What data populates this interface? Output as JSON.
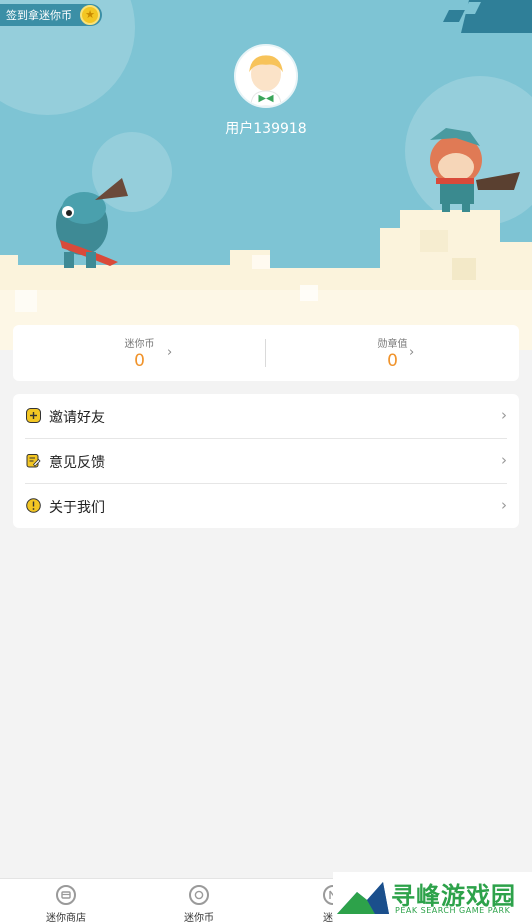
{
  "header": {
    "signin_label": "签到拿迷你币",
    "coin_glyph": "★",
    "username": "用户139918"
  },
  "stats": [
    {
      "label": "迷你币",
      "value": "0"
    },
    {
      "label": "勋章值",
      "value": "0"
    }
  ],
  "menu": [
    {
      "label": "邀请好友",
      "icon": "plus-badge-icon"
    },
    {
      "label": "意见反馈",
      "icon": "note-edit-icon"
    },
    {
      "label": "关于我们",
      "icon": "info-icon"
    }
  ],
  "chevron": "›",
  "bottom_nav": [
    {
      "label": "迷你商店",
      "icon": "store-icon"
    },
    {
      "label": "迷你币",
      "icon": "coin-icon"
    },
    {
      "label": "迷你",
      "icon": "medal-icon"
    }
  ],
  "watermark": {
    "title": "寻峰游戏园",
    "subtitle": "PEAK SEARCH GAME PARK"
  },
  "colors": {
    "banner": "#7ec4d4",
    "accent": "#f0932b",
    "icon_yellow": "#f3c623"
  }
}
